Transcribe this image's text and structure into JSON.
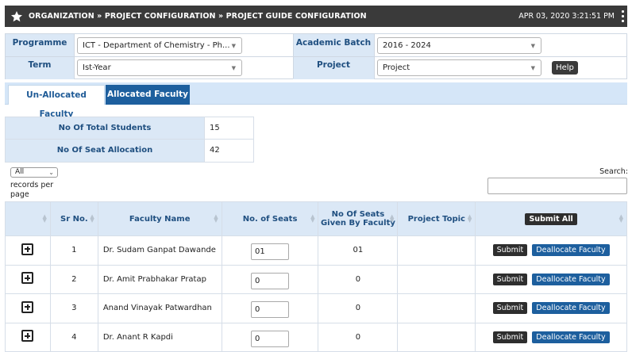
{
  "header": {
    "breadcrumb": "ORGANIZATION » PROJECT CONFIGURATION » PROJECT GUIDE CONFIGURATION",
    "datetime": "APR 03, 2020  3:21:51 PM"
  },
  "filters": {
    "programme_label": "Programme",
    "programme_value": "ICT - Department of Chemistry - Ph...",
    "academic_batch_label": "Academic Batch",
    "academic_batch_value": "2016 - 2024",
    "term_label": "Term",
    "term_value": "Ist-Year",
    "project_label": "Project",
    "project_value": "Project",
    "help_label": "Help"
  },
  "tabs": [
    {
      "label": "Un-Allocated Faculty",
      "active": false
    },
    {
      "label": "Allocated Faculty",
      "active": true
    }
  ],
  "summary": {
    "total_students_label": "No Of Total Students",
    "total_students_value": "15",
    "seat_allocation_label": "No Of Seat Allocation",
    "seat_allocation_value": "42"
  },
  "table_controls": {
    "records_per_page_value": "All",
    "records_per_page_label": "records per page",
    "search_label": "Search:"
  },
  "grid": {
    "columns": [
      "Sr No.",
      "Faculty Name",
      "No. of Seats",
      "No Of Seats Given By Faculty",
      "Project Topic"
    ],
    "submit_all_label": "Submit All",
    "submit_label": "Submit",
    "deallocate_label": "Deallocate Faculty",
    "rows": [
      {
        "sr": "1",
        "name": "Dr. Sudam Ganpat Dawande",
        "seats": "01",
        "given": "01",
        "topic": ""
      },
      {
        "sr": "2",
        "name": "Dr. Amit Prabhakar Pratap",
        "seats": "0",
        "given": "0",
        "topic": ""
      },
      {
        "sr": "3",
        "name": "Anand Vinayak Patwardhan",
        "seats": "0",
        "given": "0",
        "topic": ""
      },
      {
        "sr": "4",
        "name": "Dr. Anant R Kapdi",
        "seats": "0",
        "given": "0",
        "topic": ""
      }
    ]
  },
  "colors": {
    "topbar": "#3a3a3a",
    "accent_blue": "#1d5f9e",
    "label_blue": "#1f4f80",
    "header_bg": "#dbe8f6"
  }
}
